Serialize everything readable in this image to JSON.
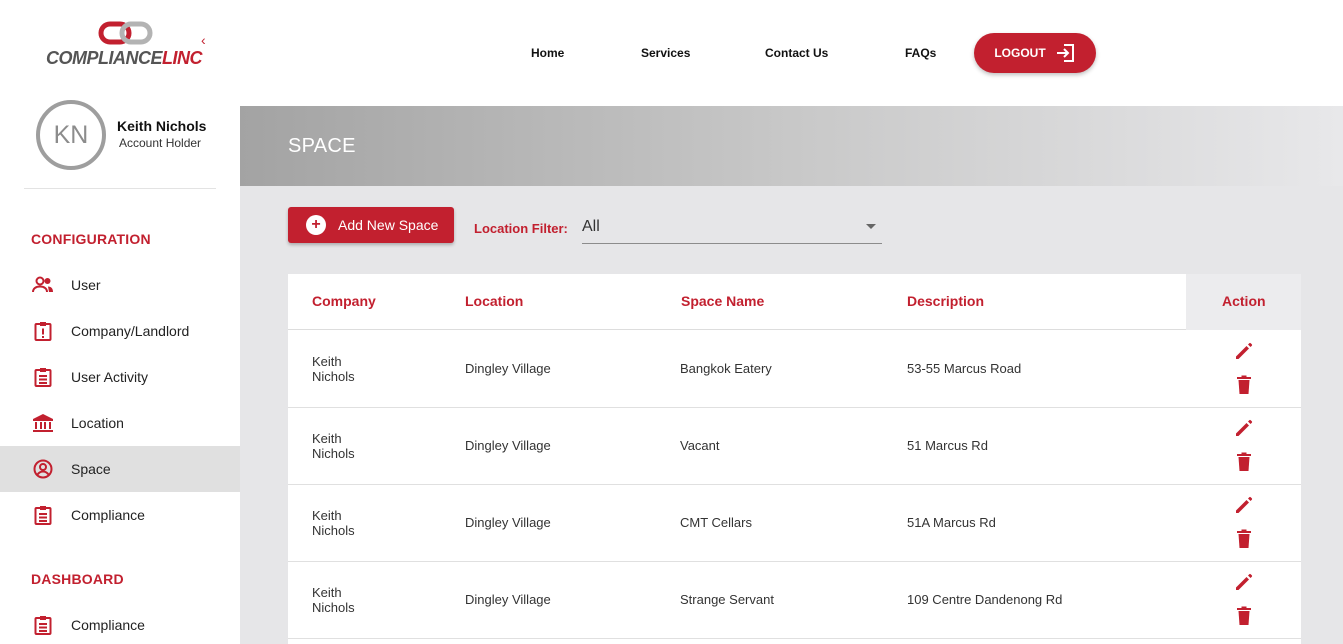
{
  "brand": {
    "part1": "COMPLIANCE",
    "part2": "LINC"
  },
  "colors": {
    "accent": "#c2202f",
    "sidebar_active": "#e0e0e0",
    "main_bg": "#e6e6e8"
  },
  "profile": {
    "initials": "KN",
    "name": "Keith Nichols",
    "role": "Account Holder"
  },
  "sidebar": {
    "configuration_title": "CONFIGURATION",
    "configuration_items": [
      {
        "label": "User",
        "icon": "users-icon"
      },
      {
        "label": "Company/Landlord",
        "icon": "alert-clipboard-icon"
      },
      {
        "label": "User Activity",
        "icon": "clipboard-list-icon"
      },
      {
        "label": "Location",
        "icon": "bank-icon"
      },
      {
        "label": "Space",
        "icon": "account-circle-icon",
        "active": true
      },
      {
        "label": "Compliance",
        "icon": "clipboard-list-icon"
      }
    ],
    "dashboard_title": "DASHBOARD",
    "dashboard_items": [
      {
        "label": "Compliance",
        "icon": "clipboard-list-icon"
      }
    ]
  },
  "topnav": {
    "home": "Home",
    "services": "Services",
    "contact": "Contact Us",
    "faqs": "FAQs",
    "logout": "LOGOUT"
  },
  "page": {
    "title": "SPACE",
    "add_button": "Add New Space",
    "filter_label": "Location Filter:",
    "filter_value": "All"
  },
  "table": {
    "headers": {
      "company": "Company",
      "location": "Location",
      "space_name": "Space Name",
      "description": "Description",
      "action": "Action"
    },
    "rows": [
      {
        "company_first": "Keith",
        "company_last": "Nichols",
        "location": "Dingley Village",
        "space_name": "Bangkok Eatery",
        "description": "53-55 Marcus Road"
      },
      {
        "company_first": "Keith",
        "company_last": "Nichols",
        "location": "Dingley Village",
        "space_name": "Vacant",
        "description": "51 Marcus Rd"
      },
      {
        "company_first": "Keith",
        "company_last": "Nichols",
        "location": "Dingley Village",
        "space_name": "CMT Cellars",
        "description": "51A Marcus Rd"
      },
      {
        "company_first": "Keith",
        "company_last": "Nichols",
        "location": "Dingley Village",
        "space_name": "Strange Servant",
        "description": "109 Centre Dandenong Rd"
      }
    ]
  }
}
